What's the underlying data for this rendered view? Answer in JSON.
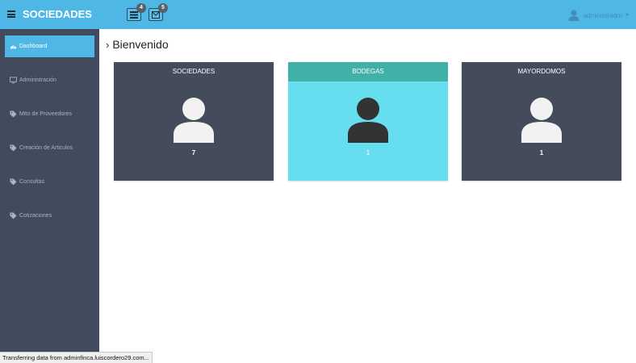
{
  "header": {
    "brand": "SOCIEDADES",
    "notifications": [
      {
        "icon": "tasks-icon",
        "count": "4"
      },
      {
        "icon": "envelope-icon",
        "count": "5"
      }
    ],
    "user": {
      "name": "administrador",
      "icon": "user-icon"
    }
  },
  "sidebar": {
    "items": [
      {
        "label": "Dashboard",
        "icon": "dashboard-icon",
        "active": true
      },
      {
        "label": "Administración",
        "icon": "desktop-icon",
        "active": false
      },
      {
        "label": "Mtto de Proveedores",
        "icon": "tag-icon",
        "active": false
      },
      {
        "label": "Creación de Articulos",
        "icon": "tag-icon",
        "active": false
      },
      {
        "label": "Consultas",
        "icon": "tag-icon",
        "active": false
      },
      {
        "label": "Cotizaciones",
        "icon": "tag-icon",
        "active": false
      }
    ]
  },
  "main": {
    "title": "Bienvenido",
    "cards": [
      {
        "title": "SOCIEDADES",
        "count": "7",
        "style": "dark"
      },
      {
        "title": "BODEGAS",
        "count": "1",
        "style": "light"
      },
      {
        "title": "MAYORDOMOS",
        "count": "1",
        "style": "dark"
      }
    ]
  },
  "status_bar": {
    "text": "Transferring data from adminfinca.luiscordero29.com..."
  },
  "colors": {
    "topbar": "#4fb7e6",
    "sidebar": "#424a5d",
    "card_dark": "#444c5c",
    "card_light_head": "#41b0a7",
    "card_light_body": "#67def0"
  }
}
